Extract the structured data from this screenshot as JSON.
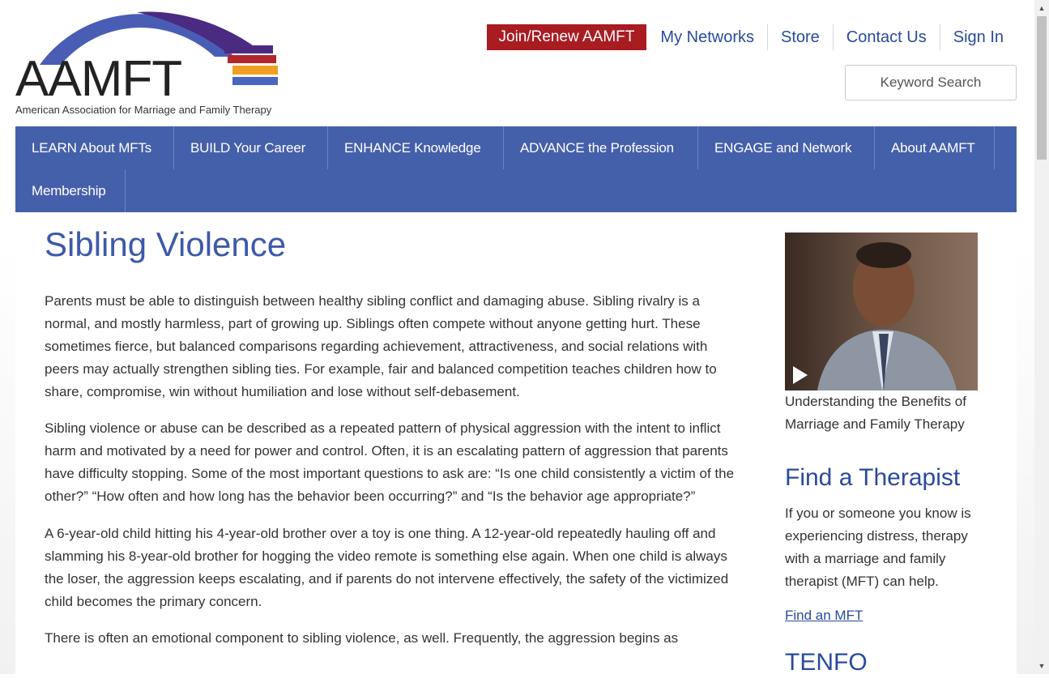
{
  "logo": {
    "wordmark": "AAMFT",
    "tagline": "American Association for Marriage and Family Therapy"
  },
  "top_links": {
    "join": "Join/Renew AAMFT",
    "networks": "My Networks",
    "store": "Store",
    "contact": "Contact Us",
    "signin": "Sign In"
  },
  "search": {
    "placeholder": "Keyword Search"
  },
  "nav": {
    "items": [
      "LEARN About MFTs",
      "BUILD Your Career",
      "ENHANCE Knowledge",
      "ADVANCE the Profession",
      "ENGAGE and Network",
      "About AAMFT",
      "Membership"
    ]
  },
  "article": {
    "title": "Sibling Violence",
    "paragraphs": [
      "Parents must be able to distinguish between healthy sibling conflict and damaging abuse. Sibling rivalry is a normal, and mostly harmless, part of growing up. Siblings often compete without anyone getting hurt. These sometimes fierce, but balanced comparisons regarding achievement, attractiveness, and social relations with peers may actually strengthen sibling ties. For example, fair and balanced competition teaches children how to share, compromise, win without humiliation and lose without self-debasement.",
      "Sibling violence or abuse can be described as a repeated pattern of physical aggression with the intent to inflict harm and motivated by a need for power and control. Often, it is an escalating pattern of aggression that parents have difficulty stopping. Some of the most important questions to ask are: “Is one child consistently a victim of the other?” “How often and how long has the behavior been occurring?” and “Is the behavior age appropriate?”",
      "A 6-year-old child hitting his 4-year-old brother over a toy is one thing. A 12-year-old repeatedly hauling off and slamming his 8-year-old brother for hogging the video remote is something else again. When one child is always the loser, the aggression keeps escalating, and if parents do not intervene effectively, the safety of the victimized child becomes the primary concern.",
      "There is often an emotional component to sibling violence, as well. Frequently, the aggression begins as"
    ]
  },
  "sidebar": {
    "video_caption": "Understanding the Benefits of Marriage and Family Therapy",
    "find_heading": "Find a Therapist",
    "find_text": "If you or someone you know is experiencing distress, therapy with a marriage and family therapist (MFT) can help.",
    "find_link": "Find an MFT",
    "next_heading": "TENFO"
  },
  "colors": {
    "brand_blue": "#4560aa",
    "link_blue": "#2a4a9c",
    "join_red": "#a81c22"
  }
}
